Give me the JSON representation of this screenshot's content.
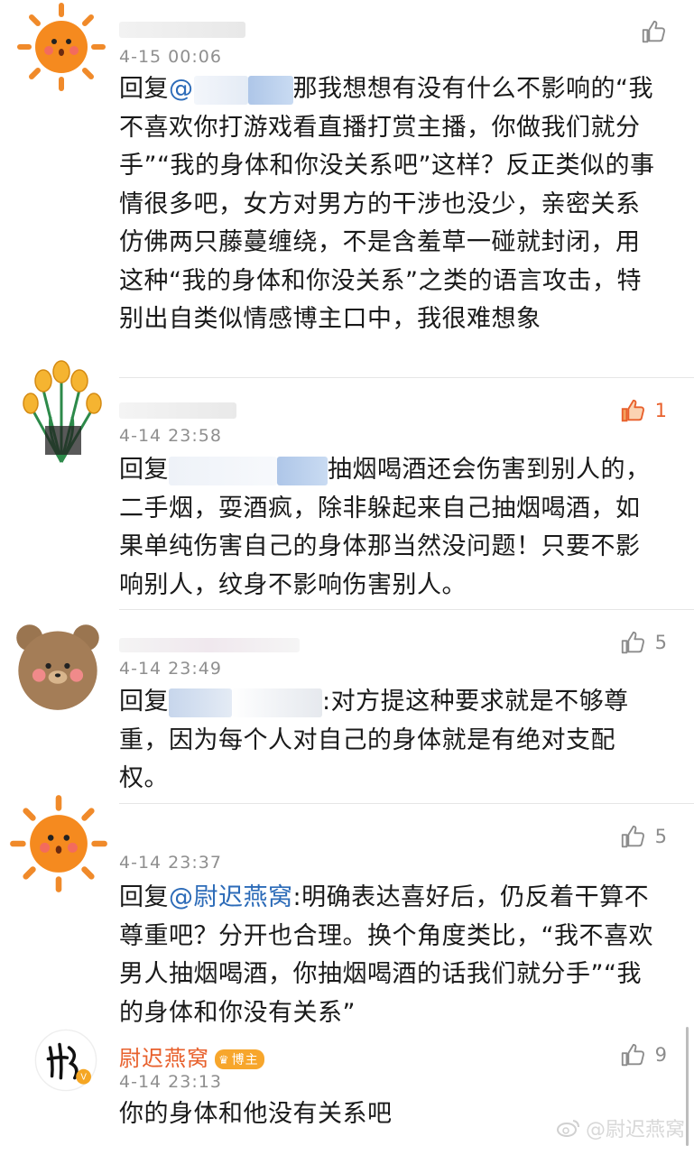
{
  "comments": [
    {
      "time": "4-15 00:06",
      "likes": "",
      "reply_prefix": "回复",
      "mention": "@",
      "separator": "",
      "text": "那我想想有没有什么不影响的“我不喜欢你打游戏看直播打赏主播，你做我们就分手”“我的身体和你没关系吧”这样？反正类似的事情很多吧，女方对男方的干涉也没少，亲密关系仿佛两只藤蔓缠绕，不是含羞草一碰就封闭，用这种“我的身体和你没关系”之类的语言攻击，特别出自类似情感博主口中，我很难想象"
    },
    {
      "time": "4-14 23:58",
      "likes": "1",
      "reply_prefix": "回复",
      "mention": "",
      "separator": "",
      "text": "抽烟喝酒还会伤害到别人的，二手烟，耍酒疯，除非躲起来自己抽烟喝酒，如果单纯伤害自己的身体那当然没问题！只要不影响别人，纹身不影响伤害别人。"
    },
    {
      "time": "4-14 23:49",
      "likes": "5",
      "reply_prefix": "回复",
      "mention": "",
      "separator": ":",
      "text": "对方提这种要求就是不够尊重，因为每个人对自己的身体就是有绝对支配权。"
    },
    {
      "time": "4-14 23:37",
      "likes": "5",
      "reply_prefix": "回复",
      "mention": "@尉迟燕窝",
      "separator": ":",
      "text": "明确表达喜好后，仍反着干算不尊重吧？分开也合理。换个角度类比，“我不喜欢男人抽烟喝酒，你抽烟喝酒的话我们就分手”“我的身体和你没有关系”"
    },
    {
      "name": "尉迟燕窝",
      "badge": "博主",
      "time": "4-14 23:13",
      "likes": "9",
      "text": "你的身体和他没有关系吧"
    }
  ],
  "watermark": "@尉迟燕窝",
  "colors": {
    "accent": "#e8602c",
    "mention": "#2c6bb8",
    "badge": "#f7a62c"
  },
  "icons": [
    "thumbs-up-icon",
    "sun-avatar",
    "tulip-avatar",
    "bear-avatar",
    "signature-avatar",
    "weibo-icon"
  ]
}
